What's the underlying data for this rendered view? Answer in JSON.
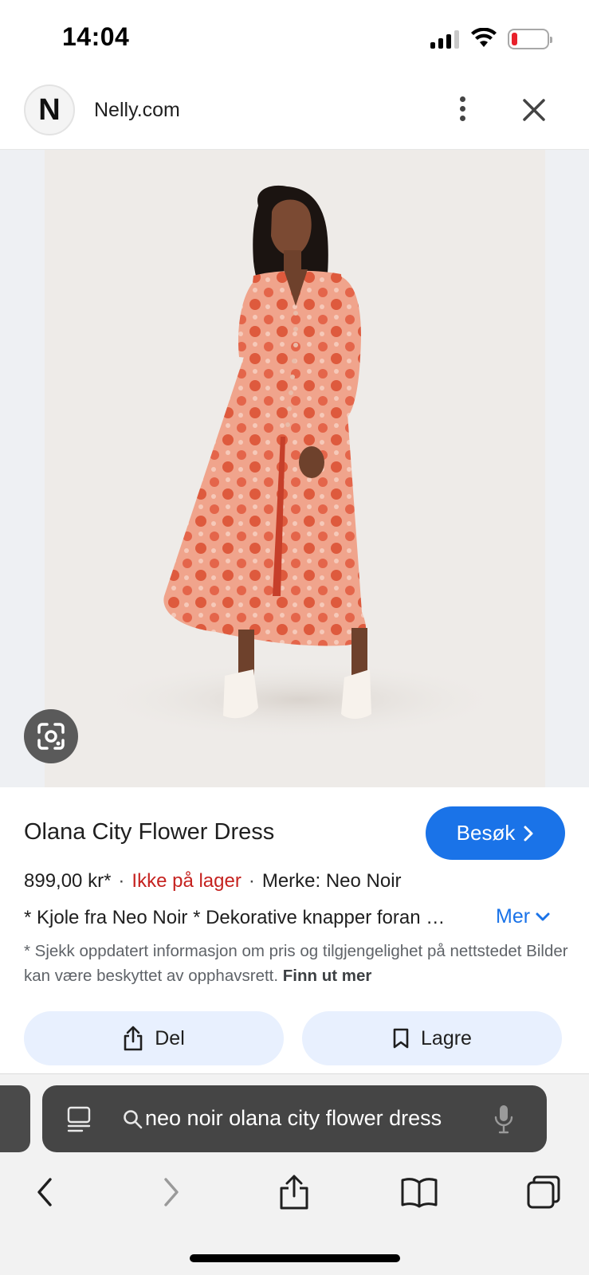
{
  "status_bar": {
    "time": "14:04",
    "battery_level": 0.15,
    "battery_color": "#e8212b",
    "signal_bars": 3
  },
  "header": {
    "logo_letter": "N",
    "site_name": "Nelly.com",
    "more_icon": "more-vert-icon",
    "close_icon": "close-icon"
  },
  "image": {
    "lens_icon": "google-lens-icon"
  },
  "product": {
    "title": "Olana City Flower Dress",
    "visit_label": "Besøk",
    "price": "899,00 kr*",
    "stock": "Ikke på lager",
    "brand": "Merke: Neo Noir",
    "description": "* Kjole fra Neo Noir * Dekorative knapper foran …",
    "more_label": "Mer",
    "disclaimer": "* Sjekk oppdatert informasjon om pris og tilgjengelighet på nettstedet Bilder kan være beskyttet av opphavsrett.",
    "learn_more": "Finn ut mer",
    "share_label": "Del",
    "save_label": "Lagre"
  },
  "browser": {
    "search_query": "neo noir olana city flower dress",
    "accent_color": "#1a73e8"
  }
}
